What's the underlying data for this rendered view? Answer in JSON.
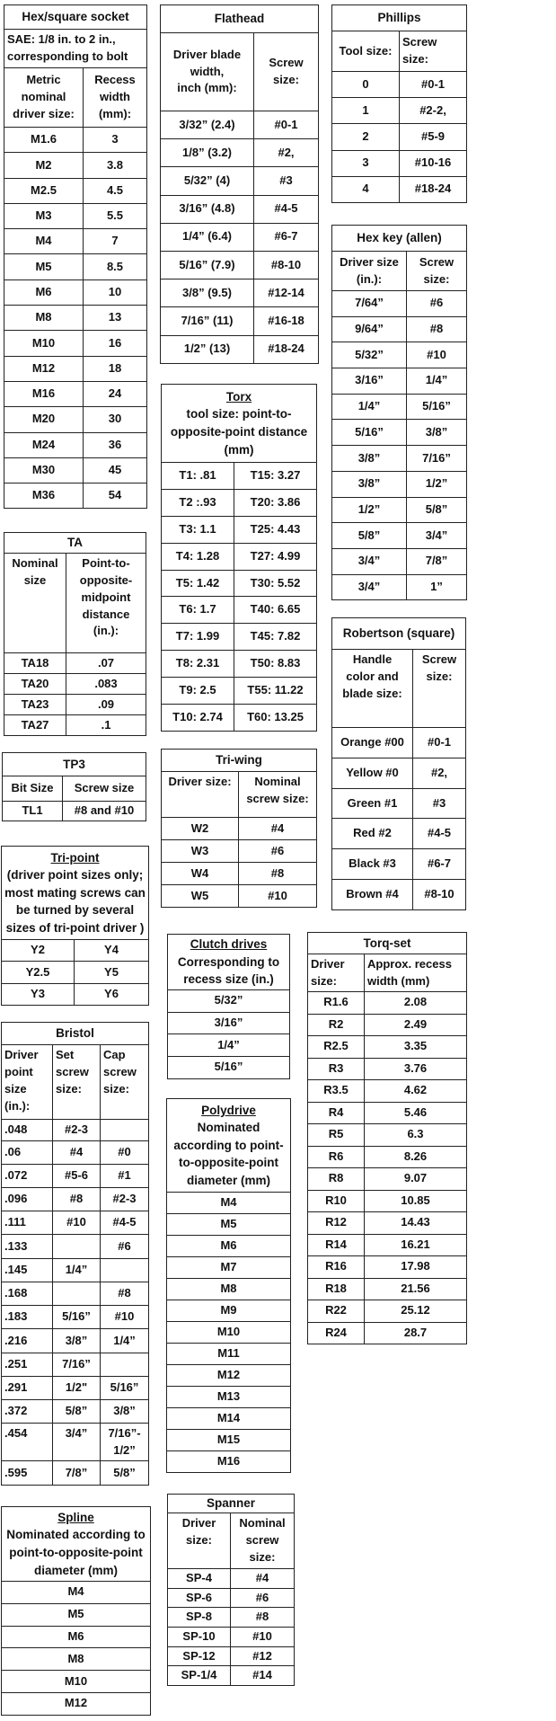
{
  "tables": [
    {
      "id": "hex-square-socket",
      "title": "Hex/square socket",
      "subtitle": "SAE:   1/8 in. to 2 in.,\ncorresponding to bolt",
      "headers": [
        "Metric\nnominal\ndriver size:",
        "Recess\nwidth\n(mm):"
      ],
      "rows": [
        [
          "M1.6",
          "3"
        ],
        [
          "M2",
          "3.8"
        ],
        [
          "M2.5",
          "4.5"
        ],
        [
          "M3",
          "5.5"
        ],
        [
          "M4",
          "7"
        ],
        [
          "M5",
          "8.5"
        ],
        [
          "M6",
          "10"
        ],
        [
          "M8",
          "13"
        ],
        [
          "M10",
          "16"
        ],
        [
          "M12",
          "18"
        ],
        [
          "M16",
          "24"
        ],
        [
          "M20",
          "30"
        ],
        [
          "M24",
          "36"
        ],
        [
          "M30",
          "45"
        ],
        [
          "M36",
          "54"
        ]
      ]
    },
    {
      "id": "flathead",
      "title": "Flathead",
      "headers": [
        "Driver blade\nwidth,\ninch (mm):",
        "Screw\nsize:"
      ],
      "rows": [
        [
          "3/32” (2.4)",
          "#0-1"
        ],
        [
          "1/8” (3.2)",
          "#2,"
        ],
        [
          "5/32” (4)",
          "#3"
        ],
        [
          "3/16” (4.8)",
          "#4-5"
        ],
        [
          "1/4” (6.4)",
          "#6-7"
        ],
        [
          "5/16” (7.9)",
          "#8-10"
        ],
        [
          "3/8” (9.5)",
          "#12-14"
        ],
        [
          "7/16” (11)",
          "#16-18"
        ],
        [
          "1/2” (13)",
          "#18-24"
        ]
      ]
    },
    {
      "id": "phillips",
      "title": "Phillips",
      "headers": [
        "Tool size:",
        "Screw\nsize:"
      ],
      "rows": [
        [
          "0",
          "#0-1"
        ],
        [
          "1",
          "#2-2,"
        ],
        [
          "2",
          "#5-9"
        ],
        [
          "3",
          "#10-16"
        ],
        [
          "4",
          "#18-24"
        ]
      ]
    },
    {
      "id": "hex-key",
      "title": "Hex key (allen)",
      "headers": [
        "Driver size\n(in.):",
        "Screw\nsize:"
      ],
      "rows": [
        [
          "7/64”",
          "#6"
        ],
        [
          "9/64”",
          "#8"
        ],
        [
          "5/32”",
          "#10"
        ],
        [
          "3/16”",
          "1/4”"
        ],
        [
          "1/4”",
          "5/16”"
        ],
        [
          "5/16”",
          "3/8”"
        ],
        [
          "3/8”",
          "7/16”"
        ],
        [
          "3/8”",
          "1/2”"
        ],
        [
          "1/2”",
          "5/8”"
        ],
        [
          "5/8”",
          "3/4”"
        ],
        [
          "3/4”",
          "7/8”"
        ],
        [
          "3/4”",
          "1”"
        ]
      ]
    },
    {
      "id": "torx",
      "title": "Torx",
      "subtitle": "tool size: point-to-\nopposite-point distance\n(mm)",
      "rows": [
        [
          "T1: .81",
          "T15: 3.27"
        ],
        [
          "T2 :.93",
          "T20: 3.86"
        ],
        [
          "T3: 1.1",
          "T25: 4.43"
        ],
        [
          "T4: 1.28",
          "T27: 4.99"
        ],
        [
          "T5: 1.42",
          "T30: 5.52"
        ],
        [
          "T6: 1.7",
          "T40: 6.65"
        ],
        [
          "T7: 1.99",
          "T45: 7.82"
        ],
        [
          "T8: 2.31",
          "T50: 8.83"
        ],
        [
          "T9: 2.5",
          "T55: 11.22"
        ],
        [
          "T10: 2.74",
          "T60: 13.25"
        ]
      ]
    },
    {
      "id": "ta",
      "title": "TA",
      "headers": [
        "Nominal\nsize",
        "Point-to-\nopposite-\nmidpoint\ndistance\n(in.):"
      ],
      "rows": [
        [
          "TA18",
          ".07"
        ],
        [
          "TA20",
          ".083"
        ],
        [
          "TA23",
          ".09"
        ],
        [
          "TA27",
          ".1"
        ]
      ]
    },
    {
      "id": "robertson",
      "title": "Robertson (square)",
      "headers": [
        "Handle\ncolor and\nblade size:",
        "Screw\nsize:"
      ],
      "rows": [
        [
          "Orange #00",
          "#0-1"
        ],
        [
          "Yellow #0",
          "#2,"
        ],
        [
          "Green #1",
          "#3"
        ],
        [
          "Red #2",
          "#4-5"
        ],
        [
          "Black #3",
          "#6-7"
        ],
        [
          "Brown #4",
          "#8-10"
        ]
      ]
    },
    {
      "id": "tp3",
      "title": "TP3",
      "headers": [
        "Bit Size",
        "Screw size"
      ],
      "rows": [
        [
          "TL1",
          "#8 and #10"
        ]
      ]
    },
    {
      "id": "tri-wing",
      "title": "Tri-wing",
      "headers": [
        "Driver size:",
        "Nominal\nscrew size:"
      ],
      "rows": [
        [
          "W2",
          "#4"
        ],
        [
          "W3",
          "#6"
        ],
        [
          "W4",
          "#8"
        ],
        [
          "W5",
          "#10"
        ]
      ]
    },
    {
      "id": "tri-point",
      "title": "Tri-point",
      "subtitle": "(driver point sizes only;\nmost mating screws can\nbe turned by several\nsizes of tri-point driver )",
      "rows": [
        [
          "Y2",
          "Y4"
        ],
        [
          "Y2.5",
          "Y5"
        ],
        [
          "Y3",
          "Y6"
        ]
      ]
    },
    {
      "id": "clutch-drives",
      "title": "Clutch drives",
      "subtitle": "Corresponding to\nrecess size (in.)",
      "rows": [
        [
          "5/32”"
        ],
        [
          "3/16”"
        ],
        [
          "1/4”"
        ],
        [
          "5/16”"
        ]
      ]
    },
    {
      "id": "torq-set",
      "title": "Torq-set",
      "headers": [
        "Driver\nsize:",
        "Approx. recess\nwidth (mm)"
      ],
      "rows": [
        [
          "R1.6",
          "2.08"
        ],
        [
          "R2",
          "2.49"
        ],
        [
          "R2.5",
          "3.35"
        ],
        [
          "R3",
          "3.76"
        ],
        [
          "R3.5",
          "4.62"
        ],
        [
          "R4",
          "5.46"
        ],
        [
          "R5",
          "6.3"
        ],
        [
          "R6",
          "8.26"
        ],
        [
          "R8",
          "9.07"
        ],
        [
          "R10",
          "10.85"
        ],
        [
          "R12",
          "14.43"
        ],
        [
          "R14",
          "16.21"
        ],
        [
          "R16",
          "17.98"
        ],
        [
          "R18",
          "21.56"
        ],
        [
          "R22",
          "25.12"
        ],
        [
          "R24",
          "28.7"
        ]
      ]
    },
    {
      "id": "bristol",
      "title": "Bristol",
      "headers": [
        "Driver\npoint\nsize\n(in.):",
        "Set\nscrew\nsize:",
        "Cap\nscrew\nsize:"
      ],
      "rows": [
        [
          ".048",
          "#2-3",
          ""
        ],
        [
          ".06",
          "#4",
          "#0"
        ],
        [
          ".072",
          "#5-6",
          "#1"
        ],
        [
          ".096",
          "#8",
          "#2-3"
        ],
        [
          ".111",
          "#10",
          "#4-5"
        ],
        [
          ".133",
          "",
          "#6"
        ],
        [
          ".145",
          "1/4”",
          ""
        ],
        [
          ".168",
          "",
          "#8"
        ],
        [
          ".183",
          "5/16”",
          "#10"
        ],
        [
          ".216",
          "3/8”",
          "1/4”"
        ],
        [
          ".251",
          "7/16”",
          ""
        ],
        [
          ".291",
          "1/2\"",
          "5/16”"
        ],
        [
          ".372",
          "5/8”",
          "3/8”"
        ],
        [
          ".454",
          "3/4”",
          "7/16”-\n1/2”"
        ],
        [
          ".595",
          "7/8”",
          "5/8”"
        ]
      ]
    },
    {
      "id": "polydrive",
      "title": "Polydrive",
      "subtitle": "Nominated\naccording to point-\nto-opposite-point\ndiameter (mm)",
      "rows": [
        [
          "M4"
        ],
        [
          "M5"
        ],
        [
          "M6"
        ],
        [
          "M7"
        ],
        [
          "M8"
        ],
        [
          "M9"
        ],
        [
          "M10"
        ],
        [
          "M11"
        ],
        [
          "M12"
        ],
        [
          "M13"
        ],
        [
          "M14"
        ],
        [
          "M15"
        ],
        [
          "M16"
        ]
      ]
    },
    {
      "id": "spline",
      "title": "Spline",
      "subtitle": "Nominated according to\npoint-to-opposite-point\ndiameter (mm)",
      "rows": [
        [
          "M4"
        ],
        [
          "M5"
        ],
        [
          "M6"
        ],
        [
          "M8"
        ],
        [
          "M10"
        ],
        [
          "M12"
        ]
      ]
    },
    {
      "id": "spanner",
      "title": "Spanner",
      "headers": [
        "Driver\nsize:",
        "Nominal\nscrew\nsize:"
      ],
      "rows": [
        [
          "SP-4",
          "#4"
        ],
        [
          "SP-6",
          "#6"
        ],
        [
          "SP-8",
          "#8"
        ],
        [
          "SP-10",
          "#10"
        ],
        [
          "SP-12",
          "#12"
        ],
        [
          "SP-1/4",
          "#14"
        ]
      ]
    }
  ]
}
